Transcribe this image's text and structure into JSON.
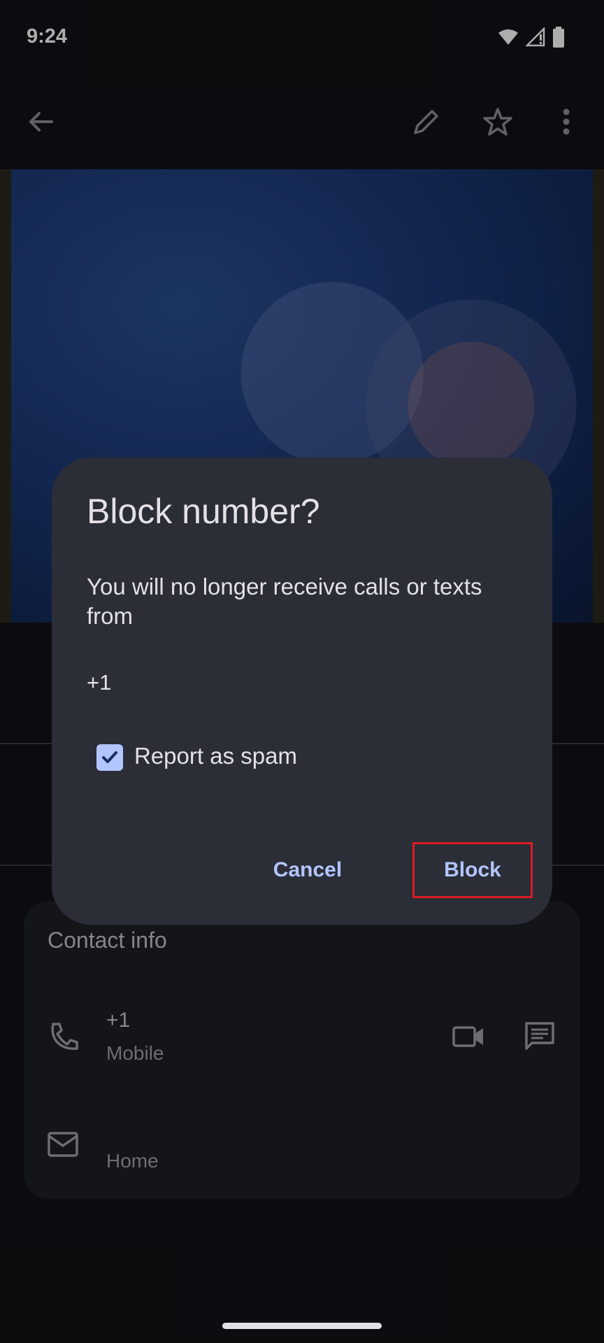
{
  "status_bar": {
    "time": "9:24",
    "icons": [
      "wifi-icon",
      "signal-icon",
      "battery-icon"
    ]
  },
  "toolbar": {
    "icons": [
      "back-arrow-icon",
      "edit-pencil-icon",
      "star-icon",
      "more-vert-icon"
    ]
  },
  "contact_card": {
    "title": "Contact info",
    "phone": {
      "number": "+1",
      "label": "Mobile",
      "icons": [
        "phone-icon",
        "video-call-icon",
        "message-icon"
      ]
    },
    "email": {
      "label": "Home",
      "icon": "mail-icon"
    }
  },
  "dialog": {
    "title": "Block number?",
    "message": "You will no longer receive calls or texts from",
    "number": "+1",
    "checkbox_label": "Report as spam",
    "checkbox_checked": true,
    "cancel_label": "Cancel",
    "block_label": "Block"
  },
  "colors": {
    "accent": "#b2c5ff",
    "dialog_bg": "#2b2d37",
    "highlight": "#e01b24"
  }
}
